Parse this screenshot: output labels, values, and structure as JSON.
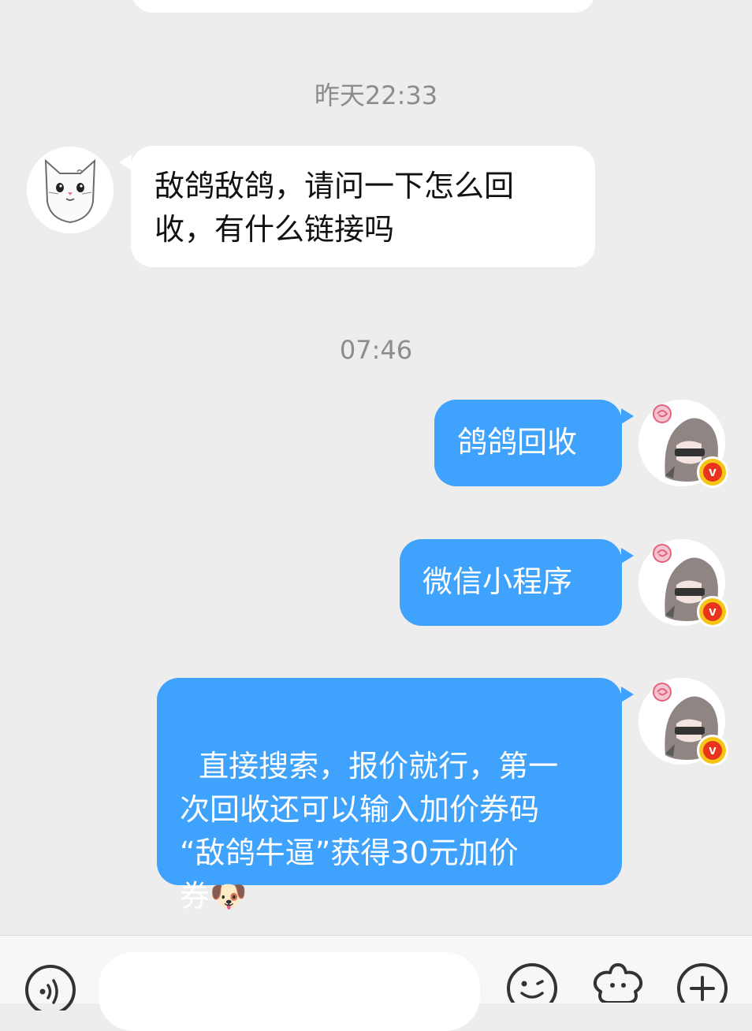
{
  "messages": {
    "time1": "昨天22:33",
    "msg1": "敌鸽敌鸽，请问一下怎么回\n收，有什么链接吗",
    "time2": "07:46",
    "msg2": "鸽鸽回收",
    "msg3": "微信小程序",
    "msg4": "直接搜索，报价就行，第一\n次回收还可以输入加价券码\n“敌鸽牛逼”获得30元加价\n券",
    "msg4_emoji": "🐶"
  },
  "input_bar": {
    "icons": [
      "voice-icon",
      "emoji-icon",
      "sticker-icon",
      "plus-icon"
    ]
  },
  "colors": {
    "background": "#ededed",
    "outgoing_bubble": "#3fa2fc",
    "incoming_bubble": "#ffffff",
    "timestamp": "#8c8c8c"
  }
}
